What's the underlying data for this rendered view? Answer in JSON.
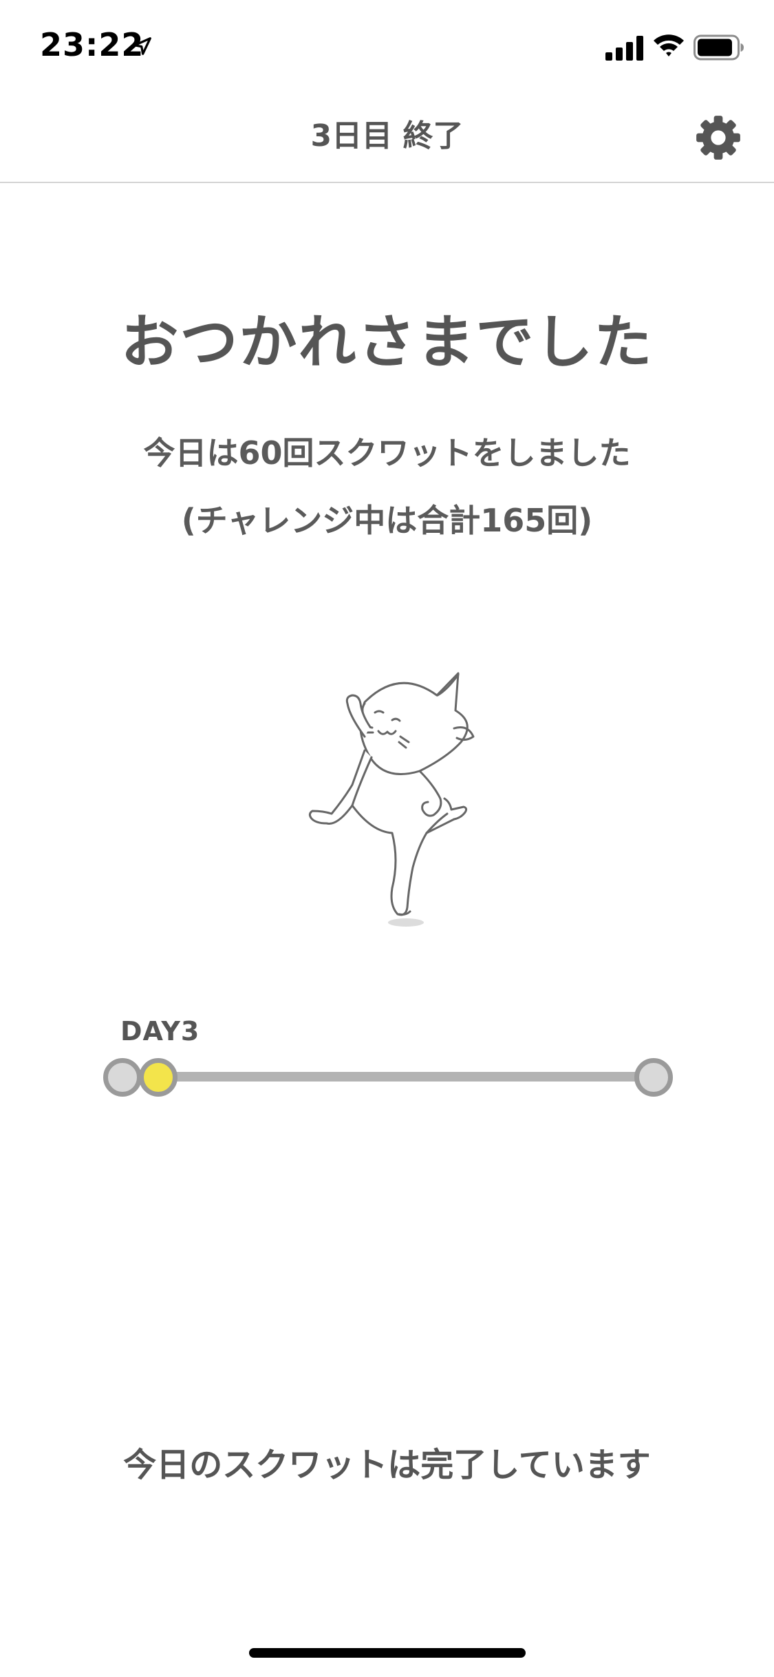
{
  "status_bar": {
    "time": "23:22",
    "icons": [
      "location-arrow-icon",
      "cellular-signal-icon",
      "wifi-icon",
      "battery-icon"
    ]
  },
  "nav": {
    "title": "3日目 終了",
    "settings_icon": "gear-icon"
  },
  "main": {
    "headline": "おつかれさまでした",
    "summary_line_1": "今日は60回スクワットをしました",
    "summary_line_2": "(チャレンジ中は合計165回)",
    "illustration": "cat-illustration"
  },
  "progress": {
    "day_label": "DAY3",
    "accent_color": "#f3e44b",
    "track_color": "#b3b3b3"
  },
  "footer": {
    "status_text": "今日のスクワットは完了しています"
  }
}
